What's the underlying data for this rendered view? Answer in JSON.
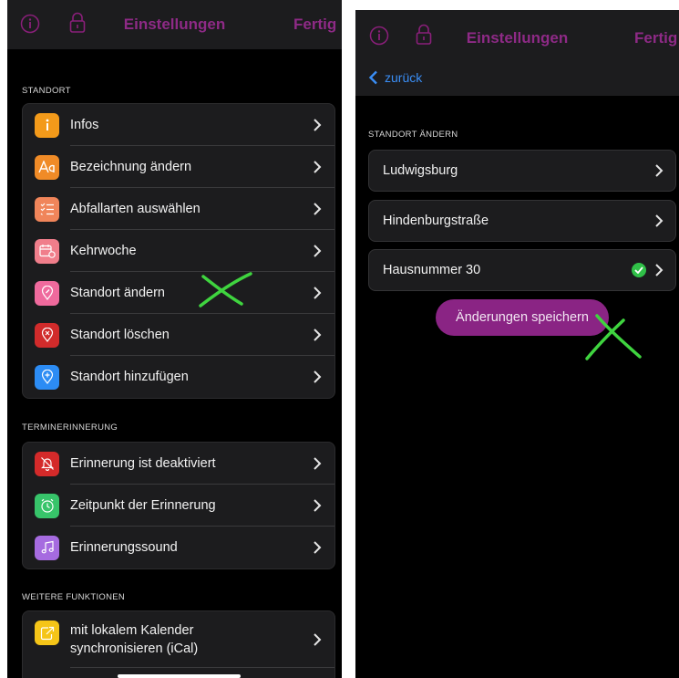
{
  "left": {
    "topbar": {
      "title": "Einstellungen",
      "done": "Fertig",
      "info_icon": "info-icon",
      "lock_icon": "lock-icon"
    },
    "sections": [
      {
        "label": "STANDORT",
        "items": [
          {
            "label": "Infos",
            "icon": "info-icon",
            "color": "#f39a1a"
          },
          {
            "label": "Bezeichnung ändern",
            "icon": "text-icon",
            "color": "#f08b27"
          },
          {
            "label": "Abfallarten auswählen",
            "icon": "checklist-icon",
            "color": "#f0855a"
          },
          {
            "label": "Kehrwoche",
            "icon": "calendar-icon",
            "color": "#f07e8b"
          },
          {
            "label": "Standort ändern",
            "icon": "location-edit-icon",
            "color": "#ef6a9d"
          },
          {
            "label": "Standort löschen",
            "icon": "location-delete-icon",
            "color": "#d12b2b"
          },
          {
            "label": "Standort hinzufügen",
            "icon": "location-add-icon",
            "color": "#2c8cf4"
          }
        ]
      },
      {
        "label": "TERMINERINNERUNG",
        "items": [
          {
            "label": "Erinnerung ist deaktiviert",
            "icon": "bell-off-icon",
            "color": "#d42a2a"
          },
          {
            "label": "Zeitpunkt der Erinnerung",
            "icon": "clock-icon",
            "color": "#37c46a"
          },
          {
            "label": "Erinnerungssound",
            "icon": "music-icon",
            "color": "#a66be0"
          }
        ]
      },
      {
        "label": "WEITERE FUNKTIONEN",
        "items": [
          {
            "label": "mit lokalem Kalender synchronisieren (iCal)",
            "line1": "mit lokalem Kalender",
            "line2": "synchronisieren (iCal)",
            "icon": "export-calendar-icon",
            "color": "#f5c518"
          }
        ]
      }
    ]
  },
  "right": {
    "topbar": {
      "title": "Einstellungen",
      "done": "Fertig",
      "info_icon": "info-icon",
      "lock_icon": "lock-icon"
    },
    "back": "zurück",
    "section_label": "STANDORT ÄNDERN",
    "cards": [
      {
        "label": "Ludwigsburg"
      },
      {
        "label": "Hindenburgstraße"
      },
      {
        "label": "Hausnummer 30",
        "checked": true
      }
    ],
    "save_button": "Änderungen speichern"
  },
  "annotation_color": "#3fd43f"
}
